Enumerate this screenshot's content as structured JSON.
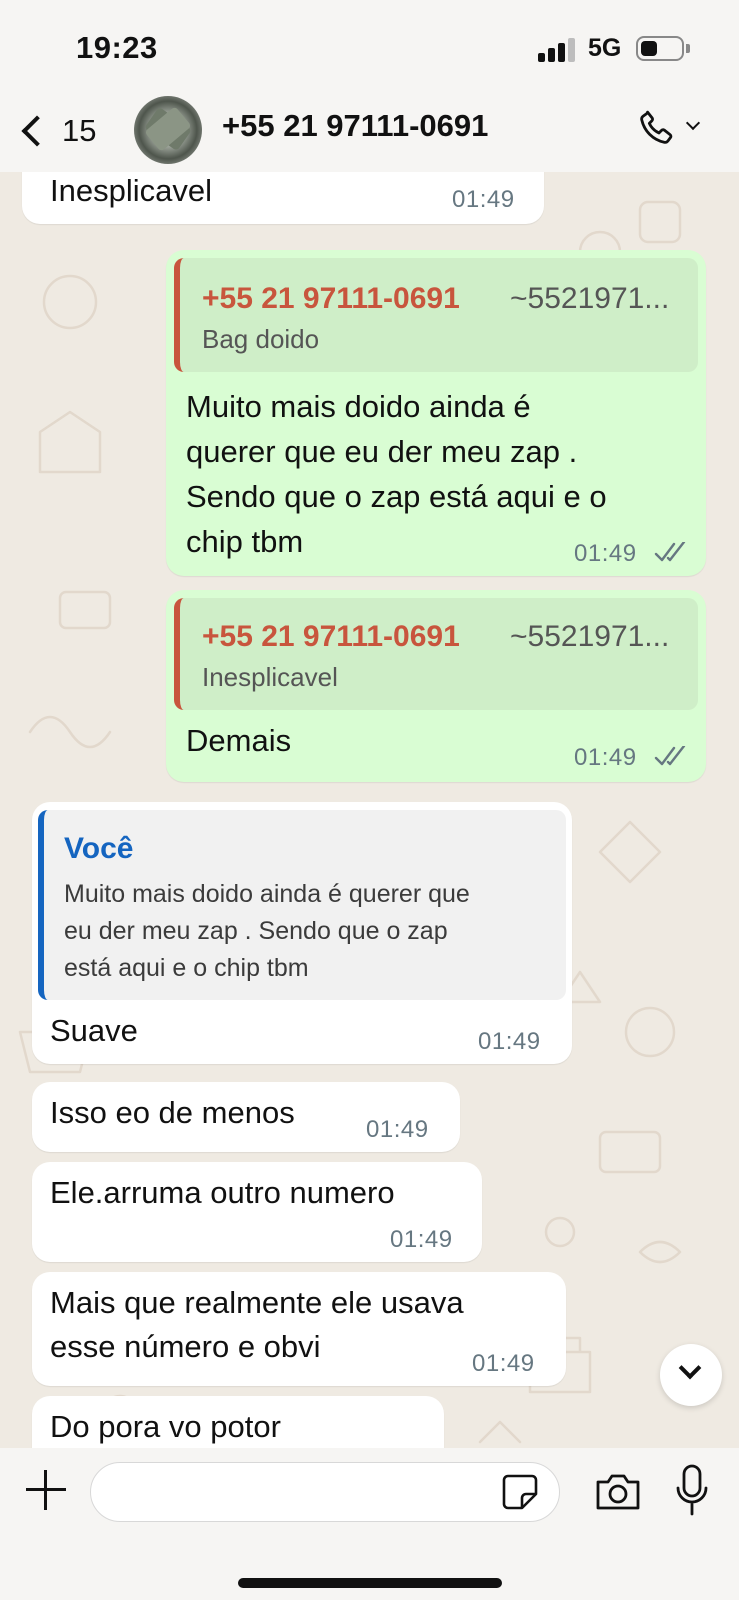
{
  "status_bar": {
    "time": "19:23",
    "network": "5G"
  },
  "header": {
    "back_count": "15",
    "contact_name": "+55 21 97111-0691"
  },
  "messages": [
    {
      "text": "Inesplicavel",
      "time": "01:49"
    },
    {
      "quote_author": "+55 21 97111-0691",
      "quote_alias": "~5521971...",
      "quote_text": "Bag doido",
      "lines": [
        "Muito mais doido ainda é",
        "querer que eu der meu zap .",
        "Sendo que o zap está aqui e o",
        "chip tbm"
      ],
      "time": "01:49"
    },
    {
      "quote_author": "+55 21 97111-0691",
      "quote_alias": "~5521971...",
      "quote_text": "Inesplicavel",
      "text": "Demais",
      "time": "01:49"
    },
    {
      "quote_author": "Você",
      "quote_lines": [
        "Muito mais doido ainda é querer que",
        "eu der meu zap . Sendo que o zap",
        "está aqui e o chip tbm"
      ],
      "text": "Suave",
      "time": "01:49"
    },
    {
      "text": "Isso eo de menos",
      "time": "01:49"
    },
    {
      "text": "Ele.arruma outro numero",
      "time": "01:49"
    },
    {
      "lines": [
        "Mais que realmente ele usava",
        "esse número e obvi"
      ],
      "time": "01:49"
    },
    {
      "text": "Do pora vo potor"
    }
  ],
  "composer": {
    "placeholder": ""
  },
  "colors": {
    "outgoing": "#d9fdd3",
    "incoming": "#ffffff",
    "quote_red": "#c8553d",
    "quote_blue": "#1565c0",
    "chat_bg": "#efeae2"
  },
  "icons": [
    "back-chevron-icon",
    "phone-icon",
    "chevron-down-icon",
    "double-check-icon",
    "plus-icon",
    "sticker-icon",
    "camera-icon",
    "microphone-icon",
    "scroll-down-icon"
  ]
}
